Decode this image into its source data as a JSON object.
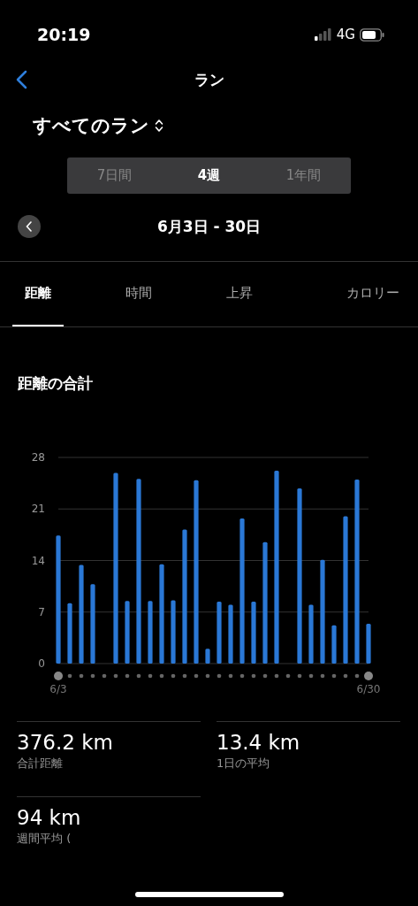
{
  "status_bar": {
    "time": "20:19",
    "network": "4G"
  },
  "nav": {
    "title": "ラン"
  },
  "filter": {
    "label": "すべてのラン"
  },
  "segments": [
    {
      "label": "7日間",
      "selected": false
    },
    {
      "label": "4週",
      "selected": true
    },
    {
      "label": "1年間",
      "selected": false
    }
  ],
  "date_range": "6月3日 - 30日",
  "tabs": [
    {
      "label": "距離",
      "selected": true
    },
    {
      "label": "時間",
      "selected": false
    },
    {
      "label": "上昇",
      "selected": false
    },
    {
      "label": "カロリー",
      "selected": false
    }
  ],
  "section_title": "距離の合計",
  "chart_data": {
    "type": "bar",
    "categories": [
      "6/3",
      null,
      null,
      null,
      null,
      null,
      null,
      null,
      null,
      null,
      null,
      null,
      null,
      null,
      null,
      null,
      null,
      null,
      null,
      null,
      null,
      null,
      null,
      null,
      null,
      null,
      null,
      "6/30"
    ],
    "series": [
      {
        "color": "#2a78d6",
        "values": [
          17.4,
          8.2,
          13.4,
          10.8,
          0,
          25.9,
          8.5,
          25.1,
          8.5,
          13.5,
          8.6,
          18.2,
          24.9,
          2.0,
          8.4,
          8.0,
          19.7,
          8.4,
          16.5,
          26.2,
          0,
          23.8,
          8.0,
          14.1,
          5.2,
          20.0,
          25.0,
          5.4
        ]
      }
    ],
    "ylim": [
      0,
      28
    ],
    "yticks": [
      0,
      7,
      14,
      21,
      28
    ],
    "grid": true
  },
  "stats": [
    {
      "value": "376.2 km",
      "label": "合計距離"
    },
    {
      "value": "13.4 km",
      "label": "1日の平均"
    },
    {
      "value": "94 km",
      "label": "週間平均 ("
    }
  ]
}
